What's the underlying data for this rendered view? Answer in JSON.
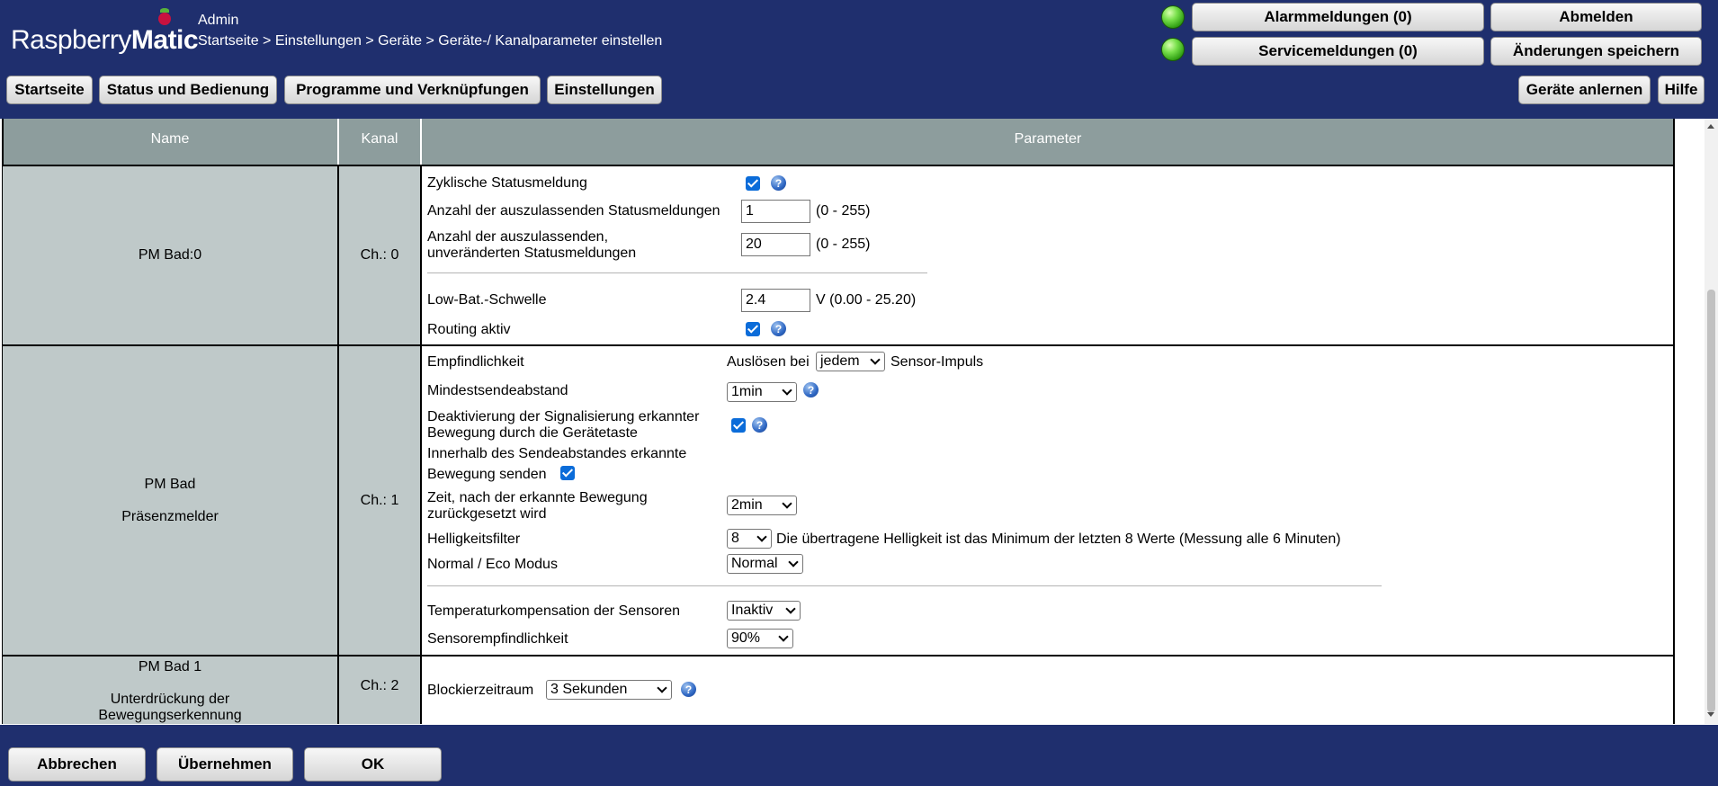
{
  "header": {
    "logo_text": "Raspberry",
    "logo_bold": "Matic",
    "user": "Admin",
    "breadcrumb": "Startseite > Einstellungen > Geräte > Geräte-/ Kanalparameter einstellen",
    "alarm_button": "Alarmmeldungen (0)",
    "service_button": "Servicemeldungen (0)",
    "logout_button": "Abmelden",
    "save_changes_button": "Änderungen speichern",
    "status_led_color": "#2e9d12"
  },
  "nav": {
    "items": [
      "Startseite",
      "Status und Bedienung",
      "Programme und Verknüpfungen",
      "Einstellungen"
    ],
    "learn_button": "Geräte anlernen",
    "help_button": "Hilfe"
  },
  "table": {
    "headers": {
      "name": "Name",
      "channel": "Kanal",
      "params": "Parameter"
    },
    "rows": [
      {
        "name": "PM Bad:0",
        "channel": "Ch.: 0",
        "params": {
          "cyclic_status": {
            "label": "Zyklische Statusmeldung",
            "checked": true
          },
          "skip_status": {
            "label": "Anzahl der auszulassenden Statusmeldungen",
            "value": "1",
            "range": "(0 - 255)"
          },
          "skip_unchanged": {
            "label_1": "Anzahl der auszulassenden,",
            "label_2": "unveränderten Statusmeldungen",
            "value": "20",
            "range": "(0 - 255)"
          },
          "low_bat": {
            "label": "Low-Bat.-Schwelle",
            "value": "2.4",
            "range": "V (0.00 - 25.20)"
          },
          "routing": {
            "label": "Routing aktiv",
            "checked": true
          }
        }
      },
      {
        "name": "PM Bad",
        "subname": "Präsenzmelder",
        "channel": "Ch.: 1",
        "params": {
          "sensitivity": {
            "label": "Empfindlichkeit",
            "prefix": "Auslösen bei",
            "value": "jedem",
            "suffix": "Sensor-Impuls"
          },
          "min_interval": {
            "label": "Mindestsendeabstand",
            "value": "1min"
          },
          "deactivate": {
            "label_1": "Deaktivierung der Signalisierung erkannter",
            "label_2": "Bewegung durch die Gerätetaste",
            "checked": true
          },
          "send_within": {
            "label_1": "Innerhalb des Sendeabstandes erkannte",
            "label_2": "Bewegung senden",
            "checked": true
          },
          "reset_time": {
            "label_1": "Zeit, nach der erkannte Bewegung",
            "label_2": "zurückgesetzt wird",
            "value": "2min"
          },
          "brightness": {
            "label": "Helligkeitsfilter",
            "value": "8",
            "note": "Die übertragene Helligkeit ist das Minimum der letzten 8 Werte (Messung alle 6 Minuten)"
          },
          "eco": {
            "label": "Normal / Eco Modus",
            "value": "Normal"
          },
          "temp_comp": {
            "label": "Temperaturkompensation der Sensoren",
            "value": "Inaktiv"
          },
          "sensor_sens": {
            "label": "Sensorempfindlichkeit",
            "value": "90%"
          }
        }
      },
      {
        "name": "PM Bad 1",
        "subname_1": "Unterdrückung der",
        "subname_2": "Bewegungserkennung",
        "channel": "Ch.: 2",
        "params": {
          "block": {
            "label": "Blockierzeitraum",
            "value": "3 Sekunden"
          }
        }
      }
    ]
  },
  "footer": {
    "cancel_button": "Abbrechen",
    "apply_button": "Übernehmen",
    "ok_button": "OK"
  }
}
